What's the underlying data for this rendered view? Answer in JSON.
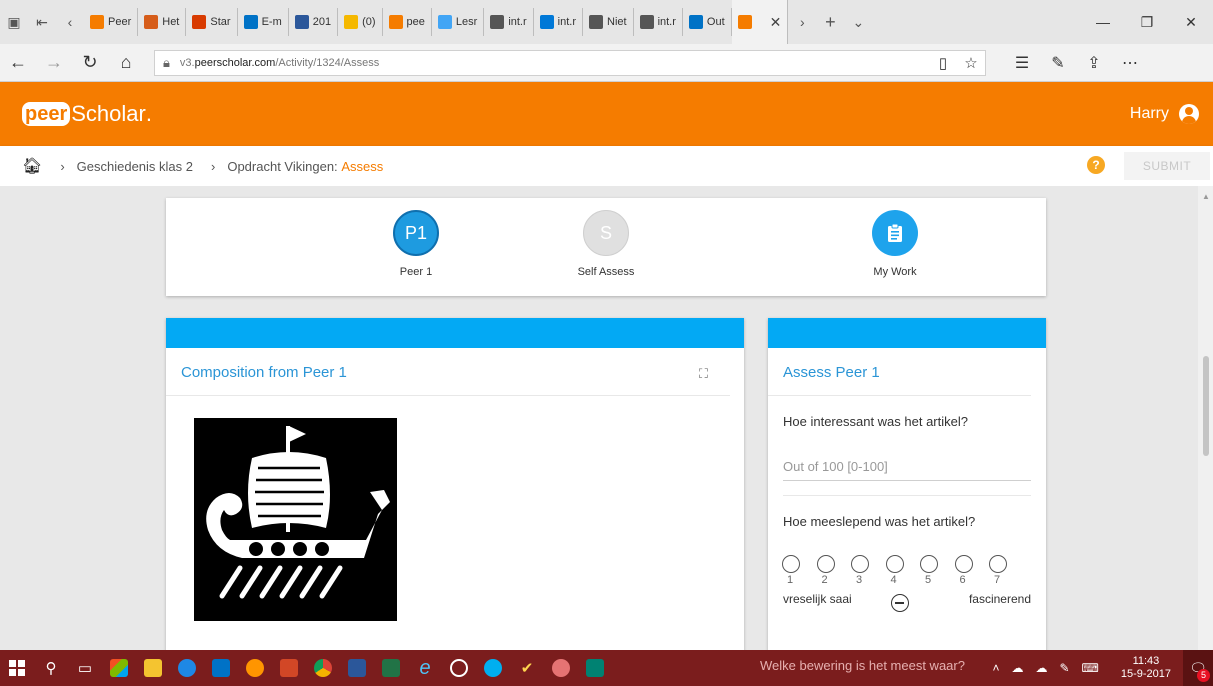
{
  "browser": {
    "tabs": [
      {
        "label": "Peer",
        "color": "#f57c00"
      },
      {
        "label": "Het",
        "color": "#d65d1a"
      },
      {
        "label": "Star",
        "color": "#d83b01"
      },
      {
        "label": "E-m",
        "color": "#0072c6"
      },
      {
        "label": "201",
        "color": "#2b579a"
      },
      {
        "label": "(0)",
        "color": "#f5b800"
      },
      {
        "label": "pee",
        "color": "#f57c00"
      },
      {
        "label": "Lesr",
        "color": "#42a5f5"
      },
      {
        "label": "int.r",
        "color": "#555555"
      },
      {
        "label": "int.r",
        "color": "#0078d7"
      },
      {
        "label": "Niet",
        "color": "#555555"
      },
      {
        "label": "int.r",
        "color": "#555555"
      },
      {
        "label": "Out",
        "color": "#0072c6"
      }
    ],
    "active_tab_color": "#f57c00",
    "url_prefix": "v3.",
    "url_domain": "peerscholar.com",
    "url_path": "/Activity/1324/Assess"
  },
  "app": {
    "logo_peer": "peer",
    "logo_scholar": "Scholar",
    "logo_dot": ".",
    "user_name": "Harry",
    "accent": "#f57c00",
    "blue": "#03a9f4"
  },
  "breadcrumb": {
    "course": "Geschiedenis klas 2",
    "assignment": "Opdracht Vikingen:",
    "current": "Assess",
    "help": "?",
    "submit": "SUBMIT"
  },
  "steps": [
    {
      "badge": "P1",
      "label": "Peer 1",
      "state": "active"
    },
    {
      "badge": "S",
      "label": "Self Assess",
      "state": "pending"
    },
    {
      "badge": "",
      "label": "My Work",
      "icon": "clipboard-icon"
    }
  ],
  "composition": {
    "title": "Composition from Peer 1"
  },
  "assess": {
    "title": "Assess Peer 1",
    "q1": "Hoe interessant was het artikel?",
    "q1_placeholder": "Out of 100 [0-100]",
    "q2": "Hoe meeslepend was het artikel?",
    "scale": [
      "1",
      "2",
      "3",
      "4",
      "5",
      "6",
      "7"
    ],
    "low_label": "vreselijk saai",
    "high_label": "fascinerend"
  },
  "taskbar": {
    "notification_text": "Welke bewering is het meest waar?",
    "time": "11:43",
    "date": "15-9-2017",
    "badge": "5"
  }
}
